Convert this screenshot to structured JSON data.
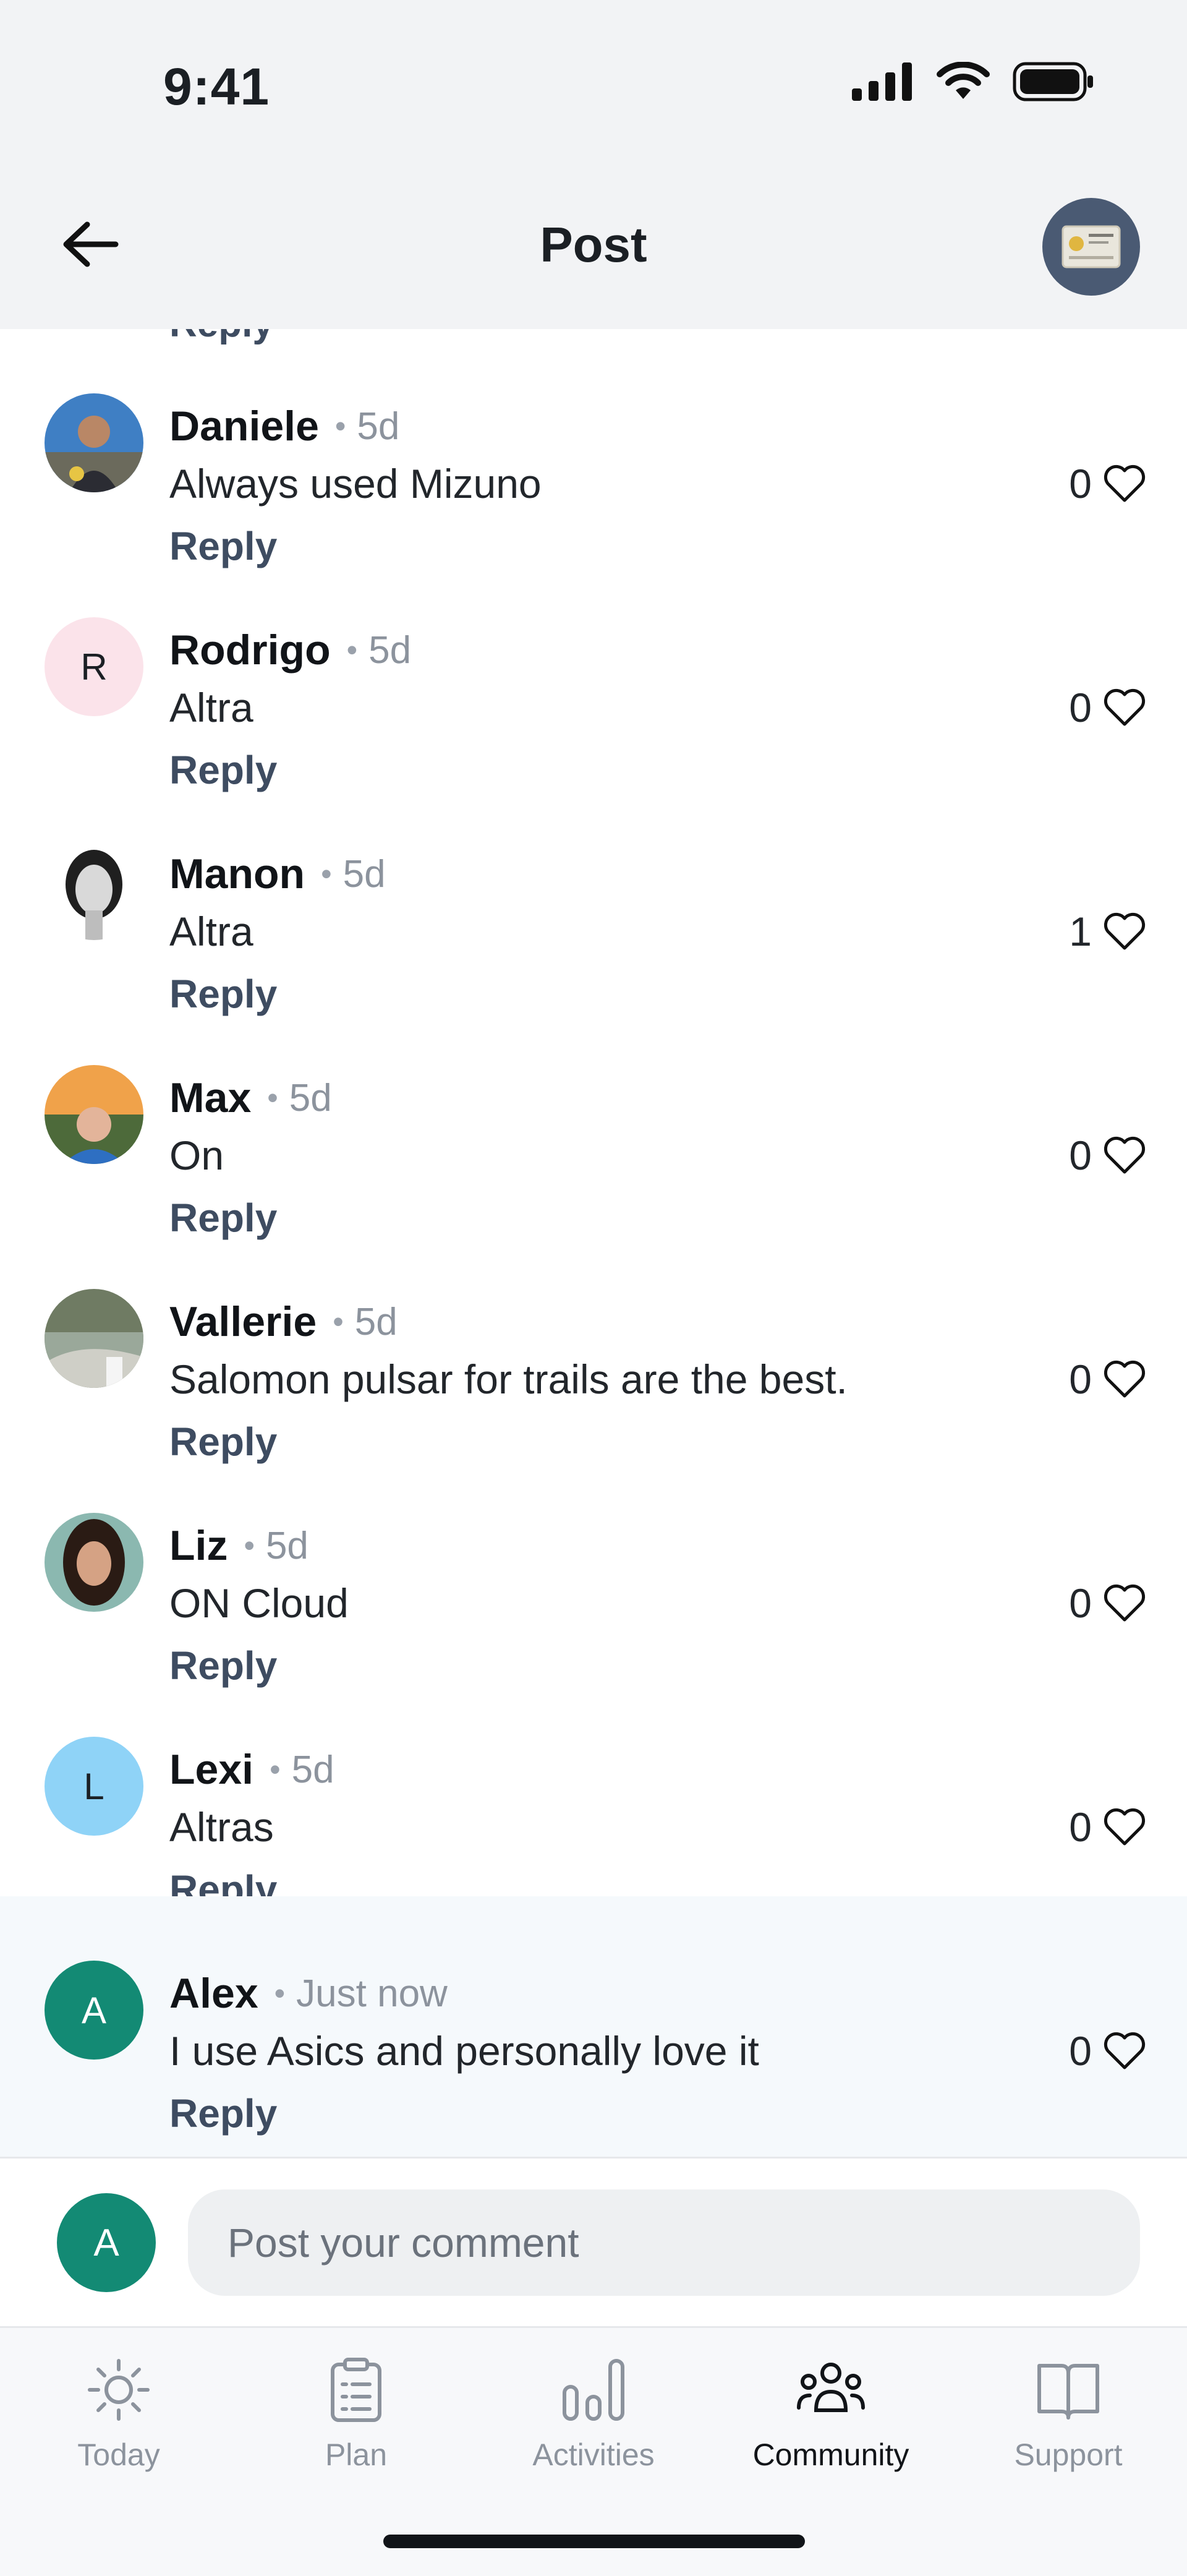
{
  "status_bar": {
    "time": "9:41"
  },
  "header": {
    "title": "Post"
  },
  "comments": [
    {
      "name": "Daniele",
      "time": "5d",
      "text": "Always used Mizuno",
      "likes": "0",
      "reply_label": "Reply",
      "avatar": {
        "type": "photo",
        "initial": ""
      }
    },
    {
      "name": "Rodrigo",
      "time": "5d",
      "text": "Altra",
      "likes": "0",
      "reply_label": "Reply",
      "avatar": {
        "type": "initial",
        "initial": "R",
        "bg": "#fbe3ea",
        "fg": "#1b1f24"
      }
    },
    {
      "name": "Manon",
      "time": "5d",
      "text": "Altra",
      "likes": "1",
      "reply_label": "Reply",
      "avatar": {
        "type": "photo",
        "initial": ""
      }
    },
    {
      "name": "Max",
      "time": "5d",
      "text": "On",
      "likes": "0",
      "reply_label": "Reply",
      "avatar": {
        "type": "photo",
        "initial": ""
      }
    },
    {
      "name": "Vallerie",
      "time": "5d",
      "text": "Salomon pulsar for trails are the best.",
      "likes": "0",
      "reply_label": "Reply",
      "avatar": {
        "type": "photo",
        "initial": ""
      }
    },
    {
      "name": "Liz",
      "time": "5d",
      "text": "ON Cloud",
      "likes": "0",
      "reply_label": "Reply",
      "avatar": {
        "type": "photo",
        "initial": ""
      }
    },
    {
      "name": "Lexi",
      "time": "5d",
      "text": "Altras",
      "likes": "0",
      "reply_label": "Reply",
      "avatar": {
        "type": "initial",
        "initial": "L",
        "bg": "#8fd3f7",
        "fg": "#1b1f24"
      }
    },
    {
      "name": "Alex",
      "time": "Just now",
      "text": "I use Asics and personally love it",
      "likes": "0",
      "reply_label": "Reply",
      "avatar": {
        "type": "initial",
        "initial": "A",
        "bg": "#138a74",
        "fg": "#ffffff"
      }
    }
  ],
  "partial_reply_label": "Reply",
  "composer": {
    "avatar_initial": "A",
    "placeholder": "Post your comment"
  },
  "nav": {
    "items": [
      {
        "label": "Today",
        "icon": "sun-icon",
        "active": false
      },
      {
        "label": "Plan",
        "icon": "clipboard-icon",
        "active": false
      },
      {
        "label": "Activities",
        "icon": "bar-chart-icon",
        "active": false
      },
      {
        "label": "Community",
        "icon": "people-icon",
        "active": true
      },
      {
        "label": "Support",
        "icon": "book-icon",
        "active": false
      }
    ]
  },
  "colors": {
    "reply": "#3e4c61",
    "accent_green": "#138a74",
    "profile_bg": "#4a5a73"
  }
}
